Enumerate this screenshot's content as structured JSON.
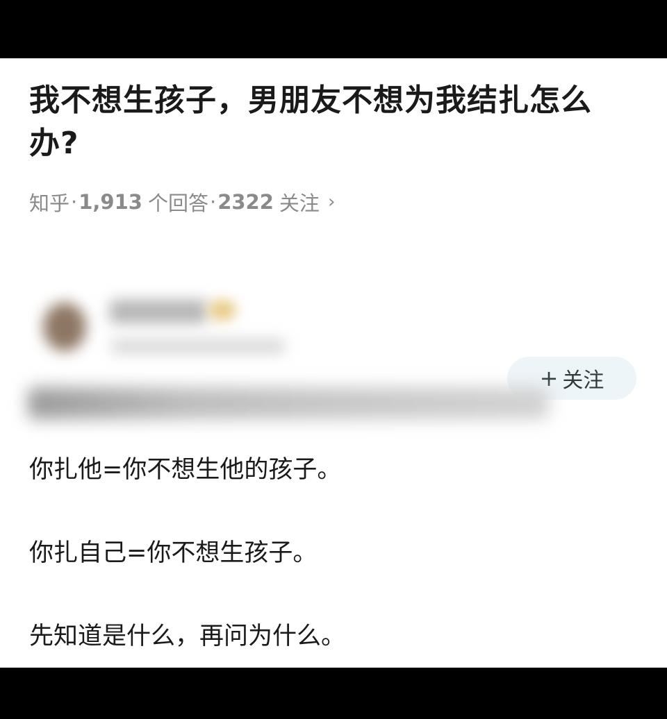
{
  "question": {
    "title": "我不想生孩子，男朋友不想为我结扎怎么办?"
  },
  "meta": {
    "source": "知乎",
    "answers_count": "1,913",
    "answers_label": "个回答",
    "followers_count": "2322",
    "followers_label": "关注",
    "separator": "·",
    "chevron": "›"
  },
  "author": {
    "follow_button_plus": "+",
    "follow_button_label": "关注"
  },
  "answer": {
    "lines": [
      "你扎他=你不想生他的孩子。",
      "你扎自己=你不想生孩子。",
      "先知道是什么，再问为什么。"
    ]
  },
  "colors": {
    "background": "#ffffff",
    "frame": "#000000",
    "title_text": "#1a1a1a",
    "meta_text": "#8a8a8a",
    "follow_button_bg": "#eef5f8"
  }
}
